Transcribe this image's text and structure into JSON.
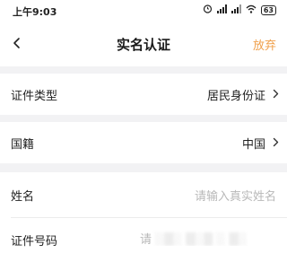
{
  "status_bar": {
    "time": "上午9:03",
    "icons": [
      "alarm-icon",
      "signal-icon",
      "signal-icon",
      "wifi-icon"
    ],
    "battery": "63"
  },
  "nav": {
    "back_label": "‹",
    "title": "实名认证",
    "giveup_label": "放弃"
  },
  "form": {
    "id_type": {
      "label": "证件类型",
      "value": "居民身份证"
    },
    "nationality": {
      "label": "国籍",
      "value": "中国"
    },
    "name": {
      "label": "姓名",
      "placeholder": "请输入真实姓名"
    },
    "id_number": {
      "label": "证件号码",
      "placeholder_visible": "请"
    }
  },
  "colors": {
    "accent": "#f0a04b",
    "background": "#f2f2f4",
    "placeholder": "#b8b8b8"
  }
}
